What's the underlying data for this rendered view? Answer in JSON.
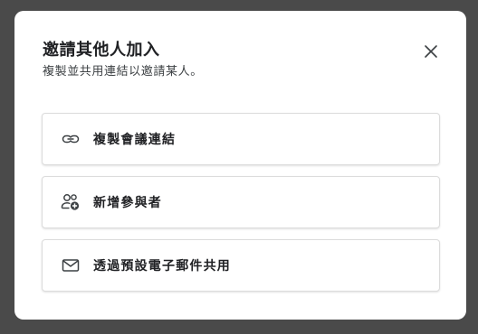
{
  "dialog": {
    "title": "邀請其他人加入",
    "subtitle": "複製並共用連結以邀請某人。",
    "close_icon": "close-icon"
  },
  "options": [
    {
      "label": "複製會議連結",
      "icon": "link-icon"
    },
    {
      "label": "新增參與者",
      "icon": "add-person-icon"
    },
    {
      "label": "透過預設電子郵件共用",
      "icon": "mail-icon"
    }
  ],
  "colors": {
    "backdrop": "#4a4a4a",
    "dialog": "#ffffff",
    "text": "#202124",
    "border": "#dcdcdc"
  }
}
